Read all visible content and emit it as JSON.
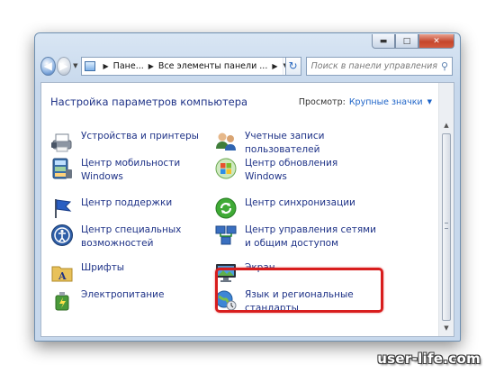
{
  "window": {
    "caption_buttons": {
      "minimize": "▬",
      "maximize": "□",
      "close": "✕"
    }
  },
  "address": {
    "crumbs": [
      "Пане...",
      "Все элементы панели ..."
    ],
    "search_placeholder": "Поиск в панели управления"
  },
  "header": {
    "title": "Настройка параметров компьютера",
    "view_label": "Просмотр:",
    "view_value": "Крупные значки"
  },
  "items": [
    {
      "label": "",
      "icon": "partial-item-icon"
    },
    {
      "label": "",
      "icon": "partial-item-icon"
    },
    {
      "label": "Устройства и принтеры",
      "icon": "printer-icon"
    },
    {
      "label": "Учетные записи пользователей",
      "icon": "user-accounts-icon"
    },
    {
      "label": "Центр мобильности Windows",
      "icon": "mobility-center-icon"
    },
    {
      "label": "Центр обновления Windows",
      "icon": "windows-update-icon"
    },
    {
      "label": "Центр поддержки",
      "icon": "action-center-flag-icon"
    },
    {
      "label": "Центр синхронизации",
      "icon": "sync-center-icon"
    },
    {
      "label": "Центр специальных возможностей",
      "icon": "accessibility-icon"
    },
    {
      "label": "Центр управления сетями и общим доступом",
      "icon": "network-center-icon"
    },
    {
      "label": "Шрифты",
      "icon": "fonts-folder-icon"
    },
    {
      "label": "Экран",
      "icon": "display-icon"
    },
    {
      "label": "Электропитание",
      "icon": "power-options-icon"
    },
    {
      "label": "Язык и региональные стандарты",
      "icon": "region-language-icon"
    }
  ],
  "colors": {
    "link_text": "#1e3287",
    "highlight": "#d81d1d",
    "title_text": "#1e3287"
  },
  "watermark": "user-life.com"
}
